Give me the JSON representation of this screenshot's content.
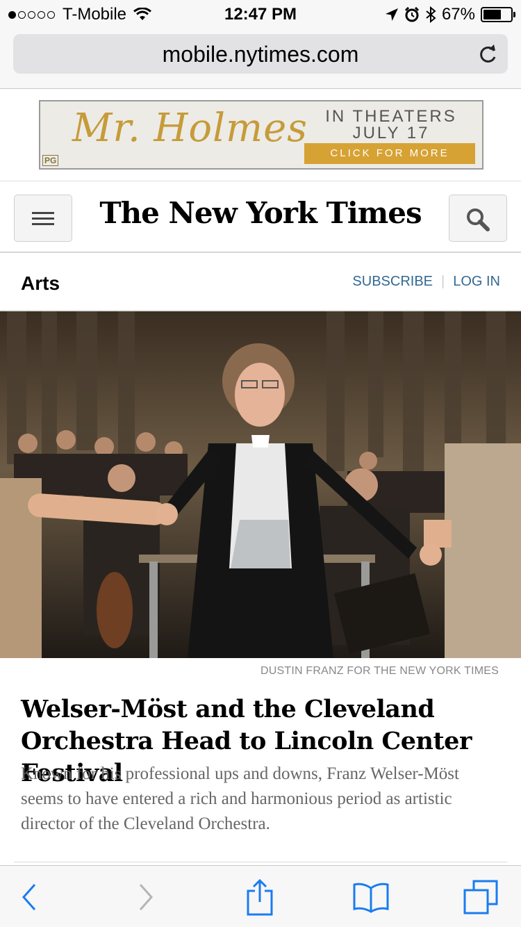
{
  "status_bar": {
    "carrier": "T-Mobile",
    "signal_bars": 1,
    "signal_total": 5,
    "time": "12:47 PM",
    "battery_percent": "67%",
    "battery_level": 0.67
  },
  "browser": {
    "url": "mobile.nytimes.com",
    "icons": [
      "wifi-icon",
      "location-arrow-icon",
      "alarm-icon",
      "bluetooth-icon",
      "battery-icon",
      "reload-icon"
    ]
  },
  "ad": {
    "title": "Mr. Holmes",
    "rating": "PG",
    "line1": "IN THEATERS",
    "line2": "JULY 17",
    "cta": "CLICK FOR MORE",
    "accent_color": "#d7a234"
  },
  "masthead": {
    "logo_text": "The New York Times"
  },
  "section": {
    "title": "Arts",
    "subscribe": "SUBSCRIBE",
    "separator": "|",
    "login": "LOG IN",
    "link_color": "#326891"
  },
  "article": {
    "photo_credit": "DUSTIN FRANZ FOR THE NEW YORK TIMES",
    "headline": "Welser-Möst and the Cleveland Orchestra Head to Lincoln Center Festival",
    "summary": "Known for his professional ups and downs, Franz Welser-Möst seems to have entered a rich and harmonious period as artistic director of the Cleveland Orchestra."
  },
  "toolbar": {
    "accent_color": "#1a7cf0",
    "disabled_color": "#b5b5b5"
  }
}
